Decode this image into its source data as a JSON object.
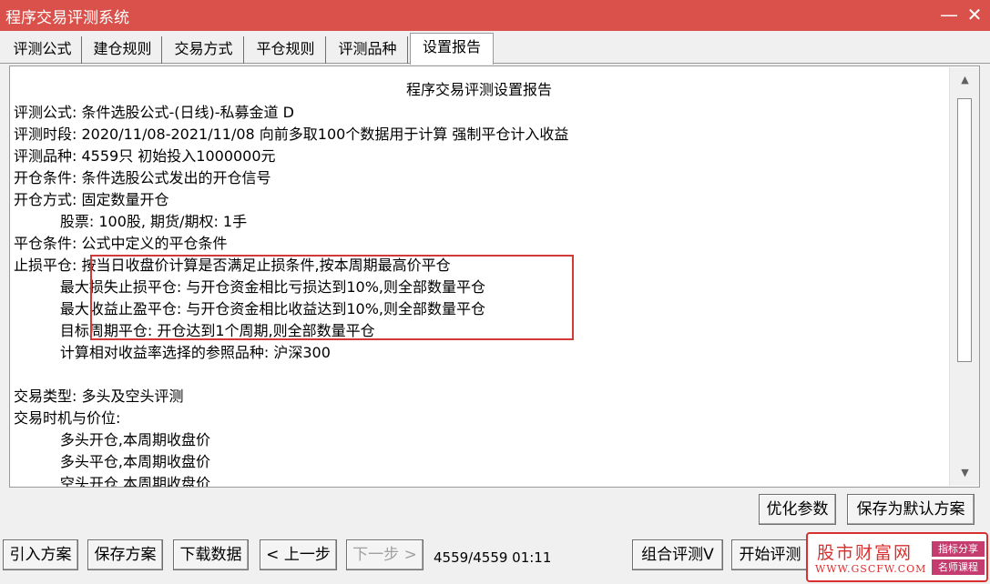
{
  "window": {
    "title": "程序交易评测系统",
    "minimize_glyph": "—",
    "close_glyph": "✕"
  },
  "tabs": [
    {
      "label": "评测公式"
    },
    {
      "label": "建仓规则"
    },
    {
      "label": "交易方式"
    },
    {
      "label": "平仓规则"
    },
    {
      "label": "评测品种"
    },
    {
      "label": "设置报告",
      "active": true
    }
  ],
  "report": {
    "title": "程序交易评测设置报告",
    "lines": [
      "评测公式: 条件选股公式-(日线)-私募金道 D",
      "评测时段: 2020/11/08-2021/11/08 向前多取100个数据用于计算 强制平仓计入收益",
      "评测品种: 4559只 初始投入1000000元",
      "开仓条件: 条件选股公式发出的开仓信号",
      "开仓方式: 固定数量开仓",
      "          股票: 100股, 期货/期权: 1手",
      "平仓条件: 公式中定义的平仓条件",
      "止损平仓: 按当日收盘价计算是否满足止损条件,按本周期最高价平仓",
      "          最大损失止损平仓: 与开仓资金相比亏损达到10%,则全部数量平仓",
      "          最大收益止盈平仓: 与开仓资金相比收益达到10%,则全部数量平仓",
      "          目标周期平仓: 开仓达到1个周期,则全部数量平仓",
      "          计算相对收益率选择的参照品种: 沪深300",
      "",
      "交易类型: 多头及空头评测",
      "交易时机与价位:",
      "          多头开仓,本周期收盘价",
      "          多头平仓,本周期收盘价",
      "          空头开仓,本周期收盘价"
    ]
  },
  "scrollbar": {
    "up_glyph": "▲",
    "down_glyph": "▼"
  },
  "panel_buttons": {
    "optimize": "优化参数",
    "save_default": "保存为默认方案"
  },
  "bottom_bar": {
    "import_plan": "引入方案",
    "save_plan": "保存方案",
    "download_data": "下载数据",
    "prev_step": "< 上一步",
    "next_step": "下一步 >",
    "status": "4559/4559  01:11",
    "combo_eval": "组合评测V",
    "start_eval": "开始评测"
  },
  "watermark": {
    "brand": "股市财富网",
    "url": "WWW.GSCFW.COM",
    "tag_top": "指标分享",
    "tag_bottom": "名师课程",
    "accent_color": "#d9302f"
  },
  "colors": {
    "titlebar": "#d9514a",
    "highlight_box": "#d23a3a"
  }
}
